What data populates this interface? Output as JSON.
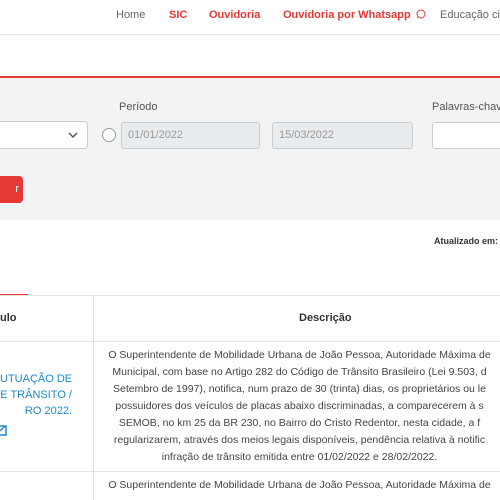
{
  "nav": {
    "home": "Home",
    "sic": "SIC",
    "ouvidoria": "Ouvidoria",
    "ouvidoria_whatsapp": "Ouvidoria por Whatsapp",
    "educacao": "Educação ci"
  },
  "filters": {
    "periodo_label": "Período",
    "palavras_label": "Palavras-chav",
    "date_start": "01/01/2022",
    "date_end": "15/03/2022",
    "search_button": "r"
  },
  "updated_label": "Atualizado em:",
  "table": {
    "headers": {
      "titulo": "ulo",
      "descricao": "Descrição"
    },
    "rows": [
      {
        "title_lines": [
          "UTUAÇÃO DE",
          "E TRÂNSITO /",
          "RO 2022."
        ],
        "description_lines": [
          "O Superintendente de Mobilidade Urbana de João Pessoa, Autoridade Máxima de",
          "Municipal, com base no Artigo 282 do Código de Trânsito Brasileiro (Lei 9.503, d",
          "Setembro de 1997), notifica, num prazo de 30 (trinta) dias, os proprietários ou le",
          "possuidores dos veículos de placas abaixo discriminadas, a comparecerem à s",
          "SEMOB, no km 25 da BR 230, no Bairro do Cristo Redentor, nesta cidade, a f",
          "regularizarem, através dos meios legais disponíveis, pendência relativa à notific",
          "infração de trânsito emitida entre 01/02/2022 e 28/02/2022."
        ]
      },
      {
        "description_lines": [
          "O Superintendente de Mobilidade Urbana de João Pessoa, Autoridade Máxima de"
        ]
      }
    ]
  },
  "colors": {
    "accent": "#e53935",
    "link": "#1e88c8"
  }
}
